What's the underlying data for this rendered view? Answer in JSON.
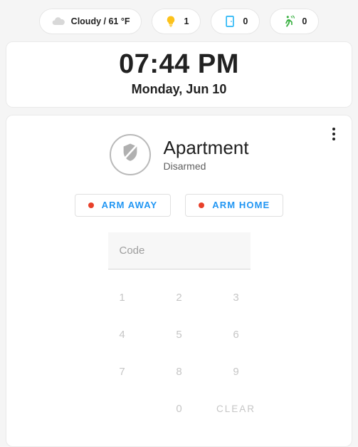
{
  "badges": [
    {
      "icon": "cloud-icon",
      "label": "Cloudy / 61 °F",
      "count": ""
    },
    {
      "icon": "lightbulb-icon",
      "label": "",
      "count": "1"
    },
    {
      "icon": "door-icon",
      "label": "",
      "count": "0"
    },
    {
      "icon": "motion-icon",
      "label": "",
      "count": "0"
    }
  ],
  "clock": {
    "time": "07:44 PM",
    "date": "Monday, Jun 10"
  },
  "alarm": {
    "icon": "shield-off-icon",
    "name": "Apartment",
    "state": "Disarmed",
    "overflow_icon": "more-vertical-icon",
    "buttons": [
      {
        "label": "ARM AWAY",
        "dot_color": "#e8402a"
      },
      {
        "label": "ARM HOME",
        "dot_color": "#e8402a"
      }
    ],
    "code": {
      "value": "",
      "placeholder": "Code"
    },
    "keypad": [
      "1",
      "2",
      "3",
      "4",
      "5",
      "6",
      "7",
      "8",
      "9",
      "",
      "0",
      "CLEAR"
    ]
  },
  "colors": {
    "accent_blue": "#2196f3",
    "alarm_red": "#e8402a",
    "light_yellow": "#fcc21b",
    "door_blue": "#29b6f6",
    "motion_green": "#3bb143",
    "page_bg": "#f5f5f5"
  }
}
